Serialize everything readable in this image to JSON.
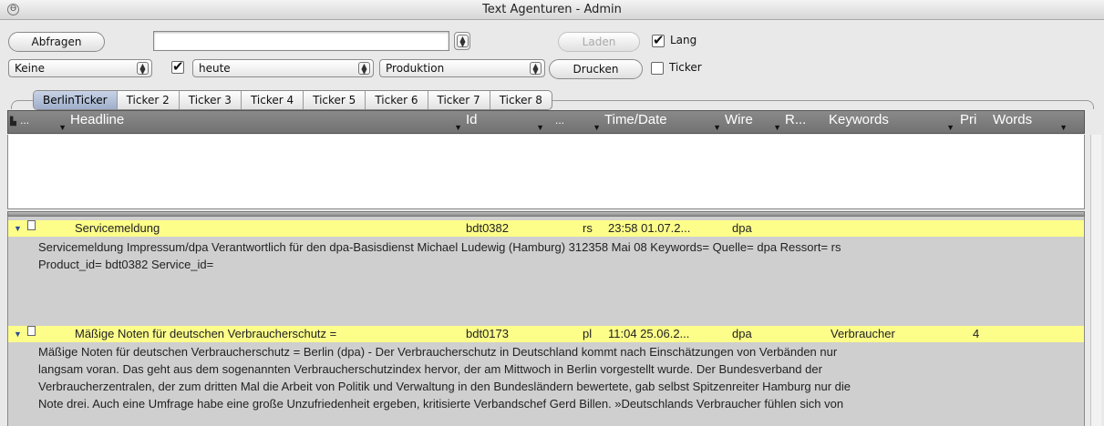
{
  "window": {
    "title": "Text Agenturen - Admin",
    "icon": "window-icon"
  },
  "toolbar": {
    "query_button": "Abfragen",
    "search_value": "",
    "load_button": "Laden",
    "lang_checkbox": {
      "label": "Lang",
      "checked": true
    },
    "filter_select": "Keine",
    "filter_checkbox_checked": true,
    "date_select": "heute",
    "mode_select": "Produktion",
    "print_button": "Drucken",
    "ticker_checkbox": {
      "label": "Ticker",
      "checked": false
    }
  },
  "tabs": [
    "BerlinTicker",
    "Ticker 2",
    "Ticker 3",
    "Ticker 4",
    "Ticker 5",
    "Ticker 6",
    "Ticker 7",
    "Ticker 8"
  ],
  "active_tab": 0,
  "columns": {
    "c0": "...",
    "headline": "Headline",
    "id": "Id",
    "c3": "...",
    "time": "Time/Date",
    "wire": "Wire",
    "r": "R...",
    "keywords": "Keywords",
    "pri": "Pri",
    "words": "Words"
  },
  "messages": [
    {
      "headline": "Servicemeldung",
      "id": "bdt0382",
      "ressort": "rs",
      "time": "23:58 01.07.2...",
      "wire": "dpa",
      "keywords": "",
      "pri": "",
      "body_lines": [
        "Servicemeldung Impressum/dpa Verantwortlich für den dpa-Basisdienst Michael Ludewig (Hamburg) 312358 Mai 08   Keywords=  Quelle= dpa Ressort= rs",
        "Product_id= bdt0382 Service_id="
      ]
    },
    {
      "headline": "Mäßige Noten für deutschen Verbraucherschutz =",
      "id": "bdt0173",
      "ressort": "pl",
      "time": "11:04 25.06.2...",
      "wire": "dpa",
      "keywords": "Verbraucher",
      "pri": "4",
      "body_lines": [
        "Mäßige Noten für deutschen Verbraucherschutz = Berlin (dpa) - Der Verbraucherschutz in Deutschland kommt nach Einschätzungen von Verbänden nur",
        "langsam voran. Das geht aus dem sogenannten Verbraucherschutzindex hervor, der am Mittwoch in Berlin vorgestellt wurde. Der Bundesverband der",
        "Verbraucherzentralen, der zum dritten Mal die Arbeit von Politik und Verwaltung in den Bundesländern bewertete, gab selbst Spitzenreiter Hamburg nur die",
        "Note drei. Auch eine Umfrage habe eine große Unzufriedenheit ergeben, kritisierte Verbandschef Gerd Billen. »Deutschlands Verbraucher fühlen sich von"
      ]
    }
  ]
}
